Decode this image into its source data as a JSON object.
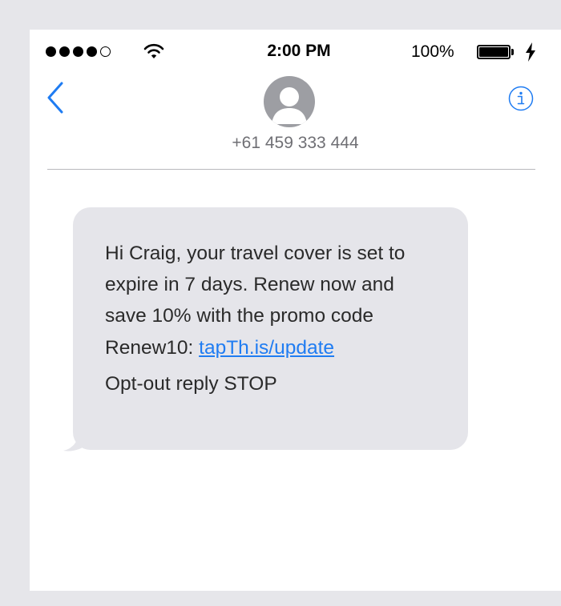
{
  "status_bar": {
    "signal_bars_filled": 4,
    "signal_bars_total": 5,
    "time": "2:00 PM",
    "battery_percent": "100%",
    "battery_level": 1.0,
    "wifi_icon": "wifi-icon",
    "charging_icon": "bolt-icon"
  },
  "header": {
    "back_icon": "chevron-left-icon",
    "avatar_icon": "person-avatar-icon",
    "contact_number": "+61 459 333 444",
    "info_icon": "info-circle-icon"
  },
  "message": {
    "text_before_link": "Hi Craig, your travel cover is set to expire in 7 days. Renew now and save 10% with the promo code Renew10: ",
    "link_text": "tapTh.is/update",
    "opt_out": "Opt-out reply STOP"
  },
  "colors": {
    "accent": "#1f7cf2",
    "bubble_background": "#e5e5ea",
    "page_background": "#e6e6ea"
  }
}
